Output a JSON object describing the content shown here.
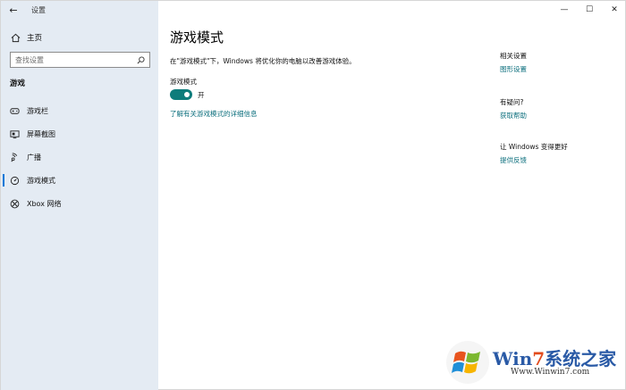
{
  "window": {
    "title": "设置",
    "back_glyph": "←",
    "minimize_glyph": "—",
    "maximize_glyph": "☐",
    "close_glyph": "✕"
  },
  "sidebar": {
    "home_label": "主页",
    "search_placeholder": "查找设置",
    "section_heading": "游戏",
    "items": [
      {
        "label": "游戏栏",
        "icon": "game-bar-icon"
      },
      {
        "label": "屏幕截图",
        "icon": "screen-capture-icon"
      },
      {
        "label": "广播",
        "icon": "broadcast-icon"
      },
      {
        "label": "游戏模式",
        "icon": "game-mode-icon",
        "active": true
      },
      {
        "label": "Xbox 网络",
        "icon": "xbox-icon"
      }
    ]
  },
  "main": {
    "title": "游戏模式",
    "description": "在\"游戏模式\"下，Windows 将优化你的电脑以改善游戏体验。",
    "toggle_label": "游戏模式",
    "toggle_state": "开",
    "toggle_on": true,
    "learn_more_link": "了解有关游戏模式的详细信息"
  },
  "aside": {
    "related_heading": "相关设置",
    "related_link": "图形设置",
    "question_heading": "有疑问?",
    "question_link": "获取帮助",
    "feedback_heading": "让 Windows 变得更好",
    "feedback_link": "提供反馈"
  },
  "watermark": {
    "brand_prefix": "Win",
    "brand_seven": "7",
    "brand_suffix": "系统之家",
    "url": "Www.Winwin7.com"
  },
  "colors": {
    "sidebar_bg": "#e4ebf3",
    "accent": "#0e7c7b",
    "link": "#0c6f7d"
  }
}
